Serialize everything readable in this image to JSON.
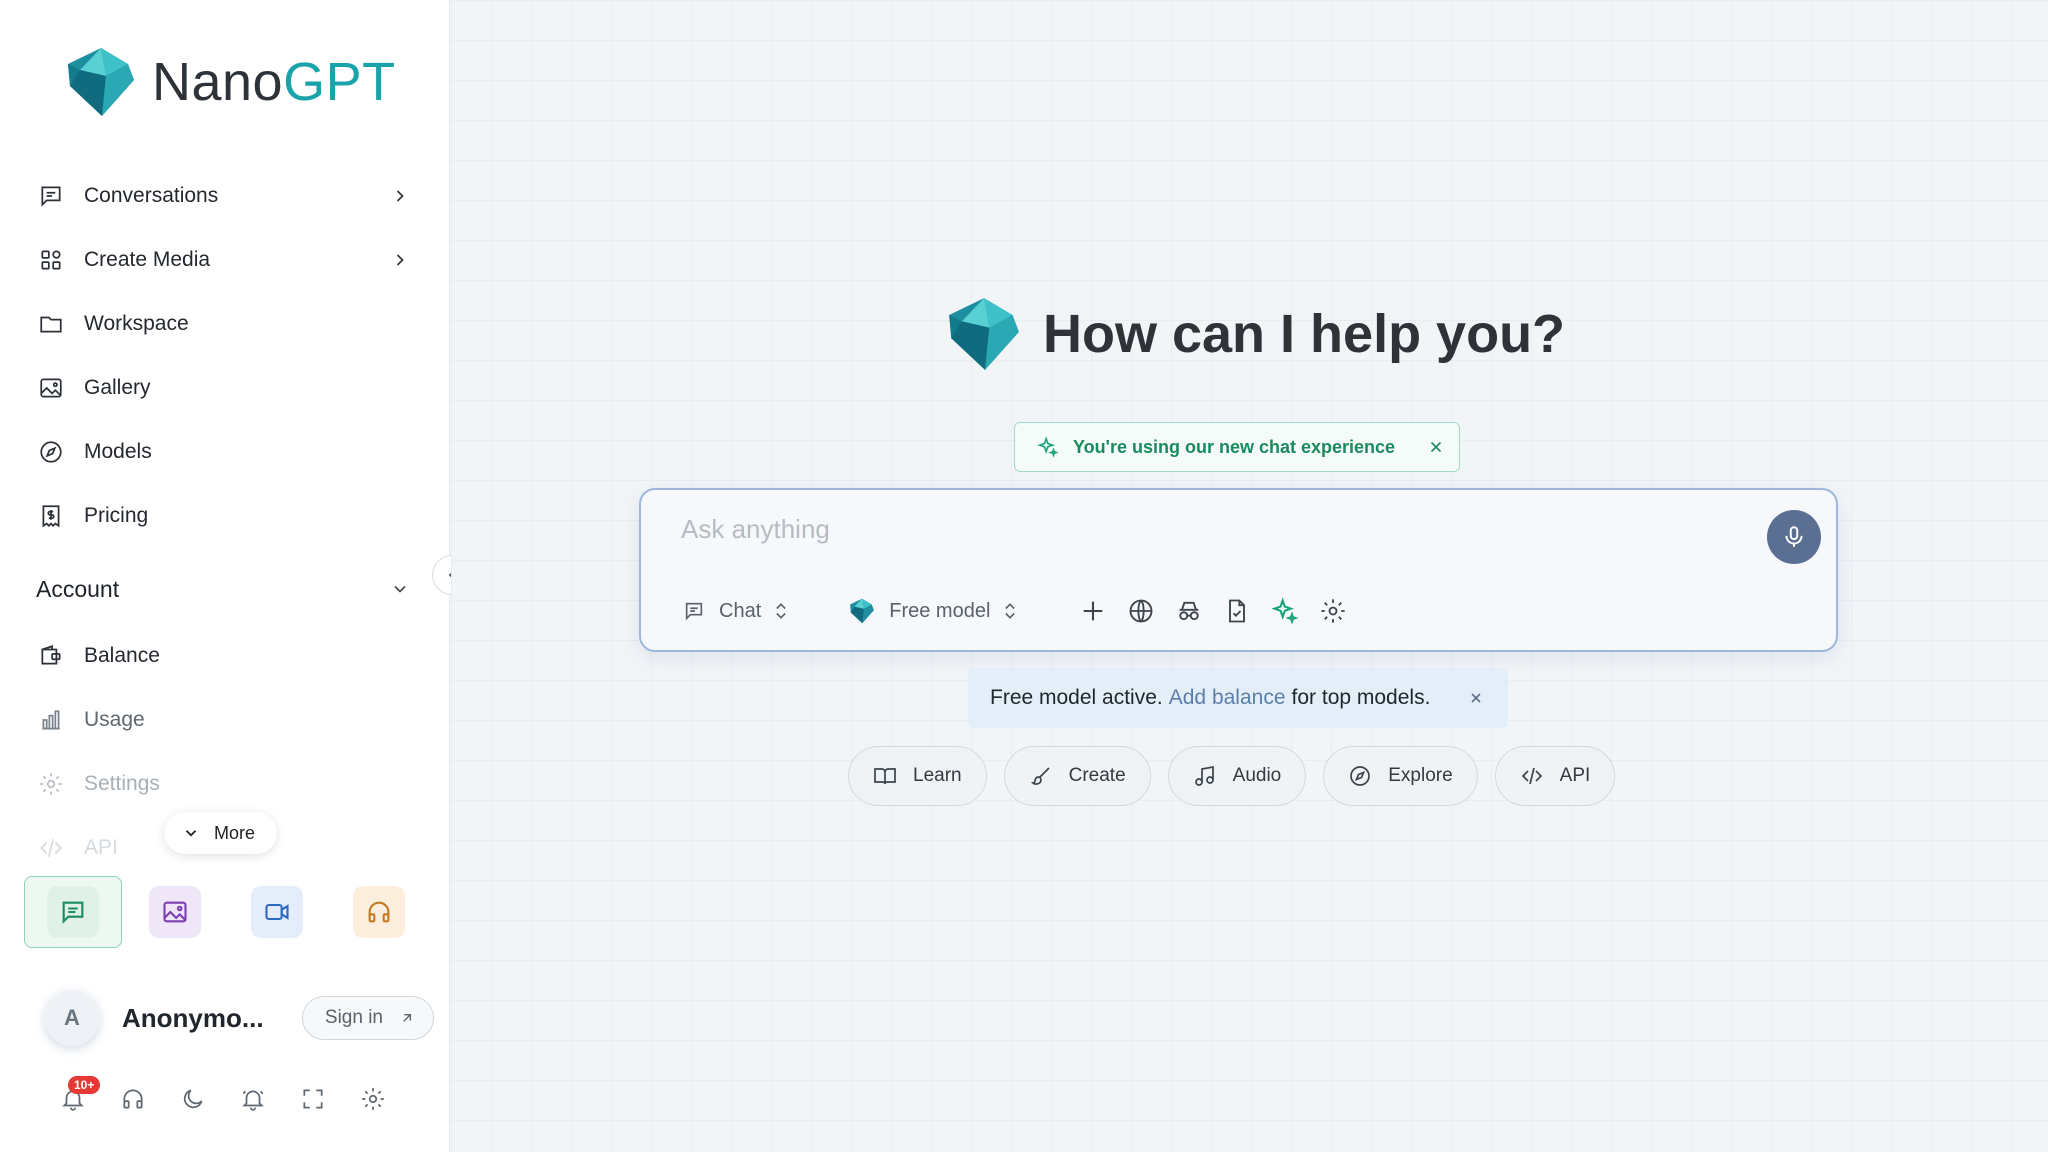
{
  "logo": {
    "part1": "Nano",
    "part2": "GPT"
  },
  "nav": {
    "items": [
      {
        "label": "Conversations",
        "icon": "message-square-icon"
      },
      {
        "label": "Create Media",
        "icon": "grid-icon"
      },
      {
        "label": "Workspace",
        "icon": "folder-icon"
      },
      {
        "label": "Gallery",
        "icon": "image-icon"
      },
      {
        "label": "Models",
        "icon": "compass-icon"
      },
      {
        "label": "Pricing",
        "icon": "receipt-dollar-icon"
      }
    ],
    "account_label": "Account",
    "account_items": [
      {
        "label": "Balance",
        "icon": "wallet-icon"
      },
      {
        "label": "Usage",
        "icon": "bar-chart-icon"
      },
      {
        "label": "Settings",
        "icon": "gear-icon"
      },
      {
        "label": "API",
        "icon": "code-icon"
      }
    ],
    "more_label": "More"
  },
  "user": {
    "initial": "A",
    "name": "Anonymo...",
    "signin_label": "Sign in"
  },
  "notifications": {
    "badge": "10+"
  },
  "main": {
    "title": "How can I help you?",
    "notice": "You're using our new chat experience",
    "composer": {
      "placeholder": "Ask anything",
      "mode_label": "Chat",
      "model_label": "Free model"
    },
    "info": {
      "prefix": "Free model active.",
      "link": "Add balance",
      "suffix": "for top models."
    },
    "chips": [
      "Learn",
      "Create",
      "Audio",
      "Explore",
      "API"
    ]
  },
  "colors": {
    "brand": "#1aa3a8",
    "accent_green": "#1a8a5f",
    "mic": "#5a6f92"
  }
}
